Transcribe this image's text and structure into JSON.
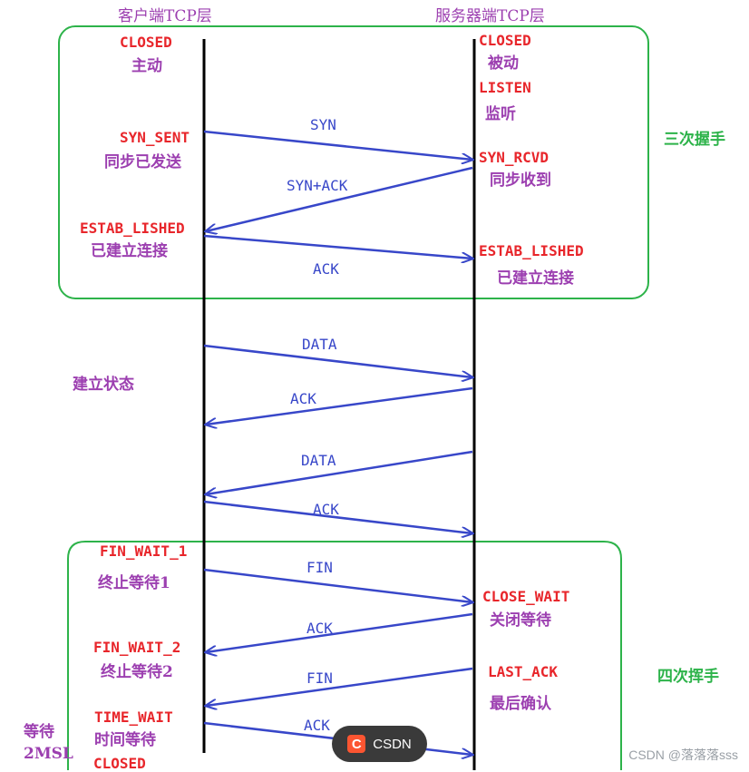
{
  "headers": {
    "client": "客户端TCP层",
    "server": "服务器端TCP层"
  },
  "groups": {
    "handshake": "三次握手",
    "teardown": "四次挥手",
    "established": "建立状态",
    "wait_2msl": "等待\n2MSL"
  },
  "client_states": [
    {
      "state": "CLOSED",
      "desc": "主动"
    },
    {
      "state": "SYN_SENT",
      "desc": "同步已发送"
    },
    {
      "state": "ESTAB_LISHED",
      "desc": "已建立连接"
    },
    {
      "state": "FIN_WAIT_1",
      "desc": "终止等待1"
    },
    {
      "state": "FIN_WAIT_2",
      "desc": "终止等待2"
    },
    {
      "state": "TIME_WAIT",
      "desc": "时间等待"
    },
    {
      "state": "CLOSED",
      "desc": ""
    }
  ],
  "server_states": [
    {
      "state": "CLOSED",
      "desc": "被动"
    },
    {
      "state": "LISTEN",
      "desc": "监听"
    },
    {
      "state": "SYN_RCVD",
      "desc": "同步收到"
    },
    {
      "state": "ESTAB_LISHED",
      "desc": "已建立连接"
    },
    {
      "state": "CLOSE_WAIT",
      "desc": "关闭等待"
    },
    {
      "state": "LAST_ACK",
      "desc": "最后确认"
    }
  ],
  "messages": [
    {
      "label": "SYN",
      "direction": "client-to-server"
    },
    {
      "label": "SYN+ACK",
      "direction": "server-to-client"
    },
    {
      "label": "ACK",
      "direction": "client-to-server"
    },
    {
      "label": "DATA",
      "direction": "client-to-server"
    },
    {
      "label": "ACK",
      "direction": "server-to-client"
    },
    {
      "label": "DATA",
      "direction": "server-to-client"
    },
    {
      "label": "ACK",
      "direction": "client-to-server"
    },
    {
      "label": "FIN",
      "direction": "client-to-server"
    },
    {
      "label": "ACK",
      "direction": "server-to-client"
    },
    {
      "label": "FIN",
      "direction": "server-to-client"
    },
    {
      "label": "ACK",
      "direction": "client-to-server"
    }
  ],
  "overlay": {
    "badge_text": "CSDN",
    "badge_logo": "C",
    "watermark": "CSDN @落落落sss"
  },
  "colors": {
    "state": "#e8262b",
    "desc": "#9c3fb0",
    "arrow": "#3847c9",
    "group": "#2db34a",
    "lifeline": "#000000"
  }
}
